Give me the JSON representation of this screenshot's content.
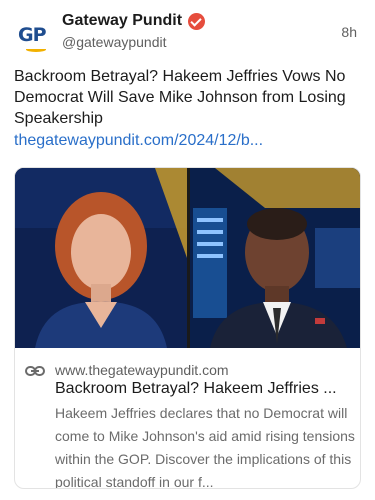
{
  "post": {
    "author_name": "Gateway Pundit",
    "handle": "@gatewaypundit",
    "time": "8h",
    "avatar_text": "GP",
    "verified_icon": "verified-badge-icon",
    "text": "Backroom Betrayal? Hakeem Jeffries Vows No Democrat Will Save Mike Johnson from Losing Speakership",
    "link": "thegatewaypundit.com/2024/12/b..."
  },
  "card": {
    "link_icon": "link-icon",
    "domain": "www.thegatewaypundit.com",
    "title": "Backroom Betrayal? Hakeem Jeffries ...",
    "description": "Hakeem Jeffries declares that no Democrat will come to Mike Johnson's aid amid rising tensions within the GOP. Discover the implications of this political standoff in our f..."
  },
  "colors": {
    "link": "#2a6fc9",
    "verified": "#e64d3d",
    "avatar_blue": "#1f4d8f",
    "avatar_gold": "#f2b100"
  }
}
